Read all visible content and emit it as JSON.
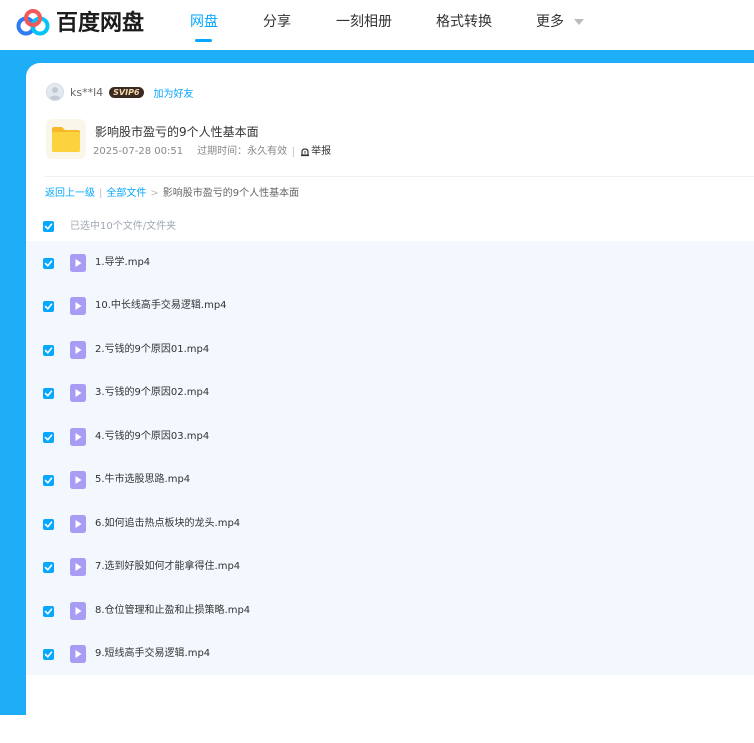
{
  "header": {
    "logo_text": "百度网盘",
    "nav": [
      {
        "label": "网盘",
        "active": true
      },
      {
        "label": "分享",
        "active": false
      },
      {
        "label": "一刻相册",
        "active": false
      },
      {
        "label": "格式转换",
        "active": false
      },
      {
        "label": "更多",
        "active": false
      }
    ]
  },
  "share": {
    "user_name": "ks**l4",
    "vip_badge": "SVIP6",
    "add_friend": "加为好友",
    "title": "影响股市盈亏的9个人性基本面",
    "date": "2025-07-28 00:51",
    "expiry": "过期时间：永久有效",
    "report": "举报"
  },
  "breadcrumb": {
    "back": "返回上一级",
    "all_files": "全部文件",
    "current": "影响股市盈亏的9个人性基本面"
  },
  "selection": {
    "label": "已选中10个文件/文件夹"
  },
  "files": [
    {
      "name": "1.导学.mp4",
      "checked": true
    },
    {
      "name": "10.中长线高手交易逻辑.mp4",
      "checked": true
    },
    {
      "name": "2.亏钱的9个原因01.mp4",
      "checked": true
    },
    {
      "name": "3.亏钱的9个原因02.mp4",
      "checked": true
    },
    {
      "name": "4.亏钱的9个原因03.mp4",
      "checked": true
    },
    {
      "name": "5.牛市选股思路.mp4",
      "checked": true
    },
    {
      "name": "6.如何追击热点板块的龙头.mp4",
      "checked": true
    },
    {
      "name": "7.选到好股如何才能拿得住.mp4",
      "checked": true
    },
    {
      "name": "8.仓位管理和止盈和止损策略.mp4",
      "checked": true
    },
    {
      "name": "9.短线高手交易逻辑.mp4",
      "checked": true
    }
  ],
  "colors": {
    "accent": "#06a7ff",
    "band": "#1eaef8",
    "list_bg": "#f2f8fd",
    "video_icon": "#a99cf5"
  }
}
